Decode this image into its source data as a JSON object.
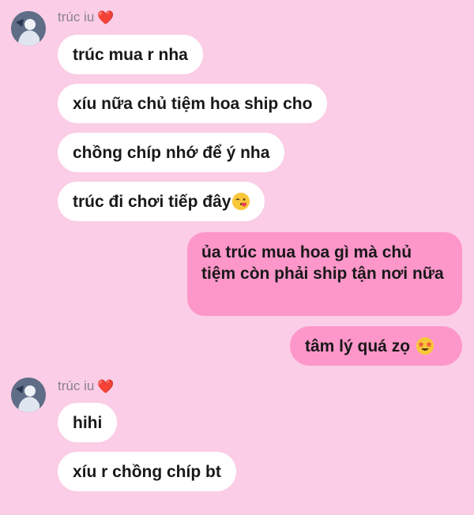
{
  "chat": {
    "groups": [
      {
        "sender": "trúc iu",
        "heart": "❤️",
        "messages": [
          "trúc mua r nha",
          "xíu nữa chủ tiệm hoa ship cho",
          "chồng chíp nhớ để ý nha",
          "trúc đi chơi tiếp đây"
        ]
      },
      {
        "sender": "trúc iu",
        "heart": "❤️",
        "messages": [
          "hihi",
          "xíu r chồng chíp bt"
        ]
      }
    ],
    "outgoing": [
      "ủa trúc mua hoa gì mà chủ tiệm còn phải ship tận nơi nữa",
      "tâm lý quá zọ"
    ],
    "emojis": {
      "kiss": "face-blowing-kiss-icon",
      "star_eyes": "star-struck-icon"
    },
    "colors": {
      "background": "#fbcde6",
      "incoming_bubble": "#ffffff",
      "outgoing_bubble": "#fd97ca",
      "sender_name": "#8a8388"
    }
  }
}
